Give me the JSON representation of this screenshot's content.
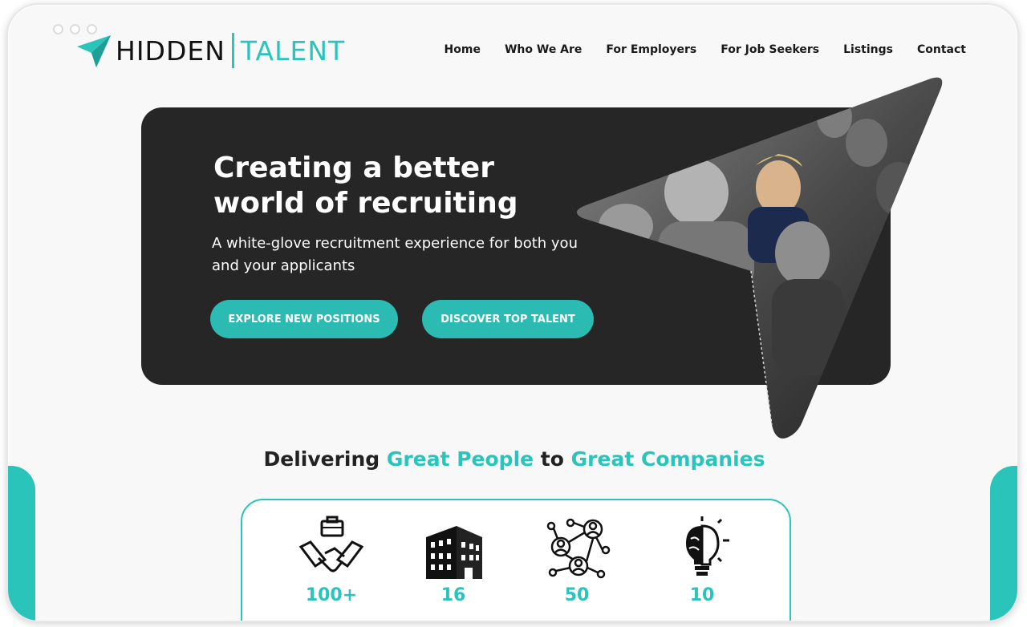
{
  "brand": {
    "name_part1": "HIDDEN",
    "name_part2": "TALENT",
    "accent_color": "#2bc4bb",
    "icon": "paper-plane-icon"
  },
  "nav": {
    "items": [
      {
        "label": "Home"
      },
      {
        "label": "Who We Are"
      },
      {
        "label": "For Employers"
      },
      {
        "label": "For Job Seekers"
      },
      {
        "label": "Listings"
      },
      {
        "label": "Contact"
      }
    ]
  },
  "hero": {
    "title": "Creating a better world of recruiting",
    "subtitle": "A white-glove recruitment experience for both you and your applicants",
    "button_explore": "EXPLORE NEW POSITIONS",
    "button_discover": "DISCOVER TOP TALENT"
  },
  "tagline": {
    "part1": "Delivering ",
    "part2": "Great People",
    "part3": " to ",
    "part4": "Great Companies"
  },
  "stats": [
    {
      "icon": "handshake-briefcase-icon",
      "value": "100+"
    },
    {
      "icon": "office-building-icon",
      "value": "16"
    },
    {
      "icon": "network-people-icon",
      "value": "50"
    },
    {
      "icon": "lightbulb-brain-icon",
      "value": "10"
    }
  ]
}
